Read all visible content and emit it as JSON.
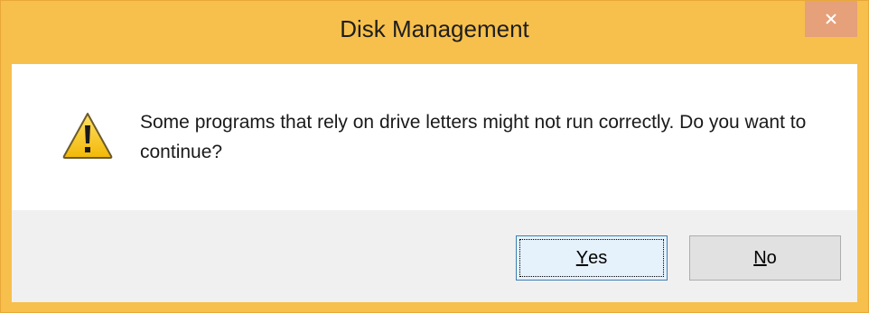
{
  "window": {
    "title": "Disk Management"
  },
  "message": {
    "text": "Some programs that rely on drive letters might not run correctly. Do you want to continue?"
  },
  "buttons": {
    "yes": {
      "mnemonic": "Y",
      "rest": "es"
    },
    "no": {
      "mnemonic": "N",
      "rest": "o"
    }
  },
  "icons": {
    "close": "close-icon",
    "warning": "warning-icon"
  },
  "colors": {
    "titlebar": "#f7c04c",
    "close_button": "#e6a07a",
    "footer": "#f0f0f0",
    "default_button_border": "#3c7fb1"
  }
}
